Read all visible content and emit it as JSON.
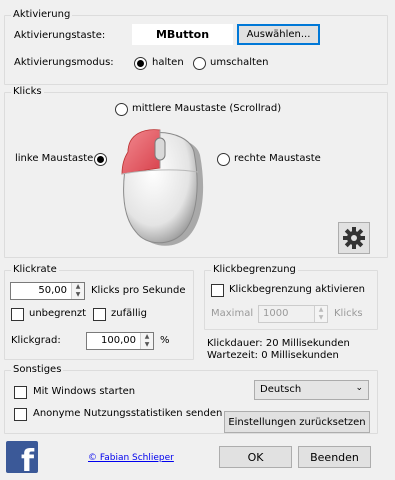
{
  "activation": {
    "group_title": "Aktivierung",
    "key_label": "Aktivierungstaste:",
    "key_value": "MButton",
    "select_button": "Auswählen...",
    "mode_label": "Aktivierungsmodus:",
    "mode_hold": "halten",
    "mode_toggle": "umschalten",
    "selected_mode": "halten"
  },
  "clicks": {
    "group_title": "Klicks",
    "middle_button": "mittlere Maustaste (Scrollrad)",
    "left_button": "linke Maustaste",
    "right_button": "rechte Maustaste",
    "selected_button": "linke Maustaste",
    "settings_icon": "gear-icon",
    "highlight_color": "#e8626b"
  },
  "click_rate": {
    "group_title": "Klickrate",
    "rate_value": "50,00",
    "rate_unit": "Klicks pro Sekunde",
    "unlimited_label": "unbegrenzt",
    "random_label": "zufällig",
    "degree_label": "Klickgrad:",
    "degree_value": "100,00",
    "degree_unit": "%"
  },
  "click_limit": {
    "group_title": "Klickbegrenzung",
    "enable_label": "Klickbegrenzung aktivieren",
    "max_label": "Maximal",
    "max_value": "1000",
    "max_unit": "Klicks"
  },
  "timing": {
    "click_duration": "Klickdauer: 20 Millisekunden",
    "wait_time": "Wartezeit: 0 Millisekunden"
  },
  "misc": {
    "group_title": "Sonstiges",
    "start_with_windows": "Mit Windows starten",
    "anonymous_stats": "Anonyme Nutzungsstatistiken senden",
    "language_value": "Deutsch",
    "reset_button": "Einstellungen zurücksetzen"
  },
  "footer": {
    "facebook_icon": "facebook-icon",
    "facebook_color": "#3b5998",
    "author_link": "© Fabian Schlieper",
    "ok_button": "OK",
    "exit_button": "Beenden"
  }
}
